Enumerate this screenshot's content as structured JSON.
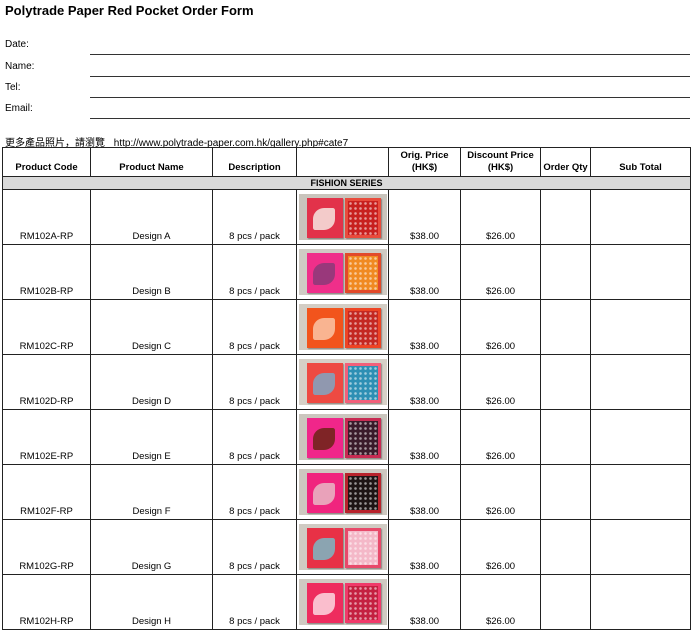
{
  "title": "Polytrade Paper Red Pocket Order Form",
  "fields": [
    {
      "label": "Date:",
      "value": ""
    },
    {
      "label": "Name:",
      "value": ""
    },
    {
      "label": "Tel:",
      "value": ""
    },
    {
      "label": "Email:",
      "value": ""
    }
  ],
  "more_photos": {
    "label": "更多產品照片，請瀏覽",
    "url": "http://www.polytrade-paper.com.hk/gallery.php#cate7"
  },
  "table": {
    "headers": {
      "code": "Product Code",
      "name": "Product Name",
      "desc": "Description",
      "image": "",
      "orig_price": "Orig. Price (HK$)",
      "discount_price": "Discount Price (HK$)",
      "qty": "Order Qty",
      "subtotal": "Sub Total"
    },
    "series_label": "FISHION SERIES",
    "rows": [
      {
        "code": "RM102A-RP",
        "name": "Design A",
        "desc": "8 pcs / pack",
        "orig": "$38.00",
        "discount": "$26.00",
        "qty": "",
        "subtotal": "",
        "left": "#e2324a",
        "right": "#e94b3c",
        "motif": "#f6e6e0",
        "rmotif": "#c8201f",
        "bg": "#c9c4bc"
      },
      {
        "code": "RM102B-RP",
        "name": "Design B",
        "desc": "8 pcs / pack",
        "orig": "$38.00",
        "discount": "$26.00",
        "qty": "",
        "subtotal": "",
        "left": "#ef2f8a",
        "right": "#e24a2a",
        "motif": "#8a3a78",
        "rmotif": "#f08a22",
        "bg": "#cfcbc4"
      },
      {
        "code": "RM102C-RP",
        "name": "Design C",
        "desc": "8 pcs / pack",
        "orig": "$38.00",
        "discount": "$26.00",
        "qty": "",
        "subtotal": "",
        "left": "#f2541c",
        "right": "#ee4424",
        "motif": "#fac6a6",
        "rmotif": "#c42822",
        "bg": "#d3cdc4"
      },
      {
        "code": "RM102D-RP",
        "name": "Design D",
        "desc": "8 pcs / pack",
        "orig": "$38.00",
        "discount": "$26.00",
        "qty": "",
        "subtotal": "",
        "left": "#ee4a42",
        "right": "#f2607a",
        "motif": "#7fa6c2",
        "rmotif": "#2e8fb4",
        "bg": "#d6d0c7"
      },
      {
        "code": "RM102E-RP",
        "name": "Design E",
        "desc": "8 pcs / pack",
        "orig": "$38.00",
        "discount": "$26.00",
        "qty": "",
        "subtotal": "",
        "left": "#f0268a",
        "right": "#c82a52",
        "motif": "#6b2414",
        "rmotif": "#3a1a2a",
        "bg": "#cbc6be"
      },
      {
        "code": "RM102F-RP",
        "name": "Design F",
        "desc": "8 pcs / pack",
        "orig": "$38.00",
        "discount": "$26.00",
        "qty": "",
        "subtotal": "",
        "left": "#f0247e",
        "right": "#b8232c",
        "motif": "#e8b8c4",
        "rmotif": "#1e1414",
        "bg": "#cdc8c0"
      },
      {
        "code": "RM102G-RP",
        "name": "Design G",
        "desc": "8 pcs / pack",
        "orig": "$38.00",
        "discount": "$26.00",
        "qty": "",
        "subtotal": "",
        "left": "#e83146",
        "right": "#e8496a",
        "motif": "#7ab8c4",
        "rmotif": "#f4b8c8",
        "bg": "#d0cbc3"
      },
      {
        "code": "RM102H-RP",
        "name": "Design H",
        "desc": "8 pcs / pack",
        "orig": "$38.00",
        "discount": "$26.00",
        "qty": "",
        "subtotal": "",
        "left": "#ee2c5e",
        "right": "#f03a6a",
        "motif": "#fbd8e0",
        "rmotif": "#c42040",
        "bg": "#cfcac2"
      }
    ]
  }
}
